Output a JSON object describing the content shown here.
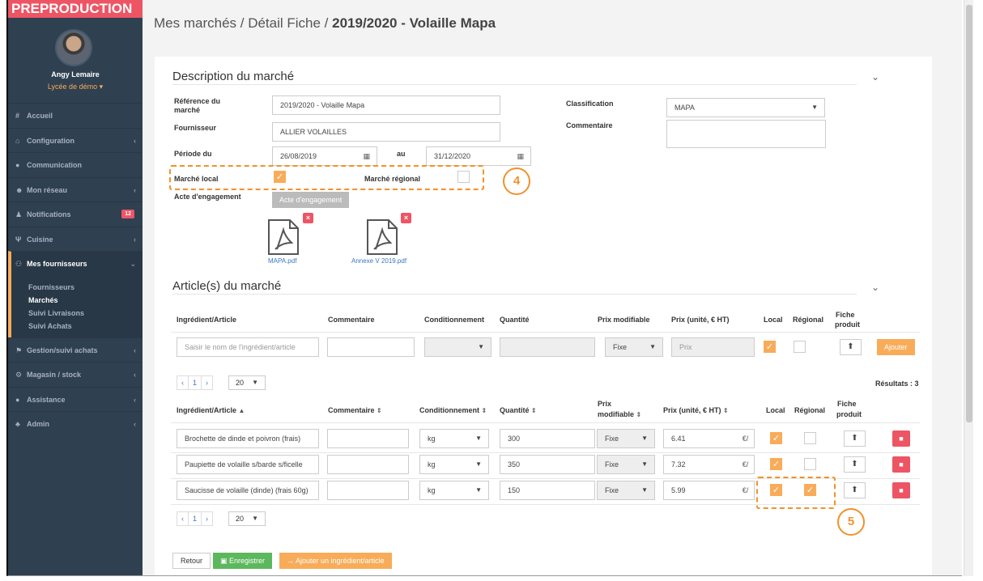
{
  "env_banner": "PREPRODUCTION",
  "user": {
    "name": "Angy Lemaire",
    "school": "Lycée de démo ▾"
  },
  "nav": {
    "items": [
      {
        "icon": "#",
        "label": "Accueil",
        "chevron": ""
      },
      {
        "icon": "⌂",
        "label": "Configuration",
        "chevron": "‹"
      },
      {
        "icon": "●",
        "label": "Communication",
        "chevron": ""
      },
      {
        "icon": "☻",
        "label": "Mon réseau",
        "chevron": "‹"
      },
      {
        "icon": "♟",
        "label": "Notifications",
        "badge": "12"
      },
      {
        "icon": "Ψ",
        "label": "Cuisine",
        "chevron": "‹"
      }
    ],
    "active": {
      "icon": "⚇",
      "label": "Mes fournisseurs",
      "chevron": "⌄"
    },
    "sub": [
      "Fournisseurs",
      "Marchés",
      "Suivi Livraisons",
      "Suivi Achats"
    ],
    "after": [
      {
        "icon": "⚑",
        "label": "Gestion/suivi achats",
        "chevron": "‹"
      },
      {
        "icon": "⚙",
        "label": "Magasin / stock",
        "chevron": "‹"
      },
      {
        "icon": "●",
        "label": "Assistance",
        "chevron": "‹"
      },
      {
        "icon": "♣",
        "label": "Admin",
        "chevron": "‹"
      }
    ]
  },
  "breadcrumb": {
    "part1": "Mes marchés / Détail Fiche / ",
    "current": "2019/2020 - Volaille Mapa"
  },
  "description": {
    "title": "Description du marché",
    "ref_label": "Référence du marché",
    "ref_value": "2019/2020 - Volaille Mapa",
    "fournisseur_label": "Fournisseur",
    "fournisseur_value": "ALLIER VOLAILLES",
    "periode_label": "Période du",
    "date_from": "26/08/2019",
    "au_label": "au",
    "date_to": "31/12/2020",
    "local_label": "Marché local",
    "regional_label": "Marché régional",
    "acte_label": "Acte d'engagement",
    "acte_button": "Acte d'engagement",
    "classification_label": "Classification",
    "classification_value": "MAPA",
    "commentaire_label": "Commentaire",
    "files": [
      "MAPA.pdf",
      "Annexe V 2019.pdf"
    ]
  },
  "callouts": {
    "c4": "4",
    "c5": "5"
  },
  "articles": {
    "title": "Article(s) du marché",
    "headers": {
      "ingredient": "Ingrédient/Article",
      "commentaire": "Commentaire",
      "conditionnement": "Conditionnement",
      "quantite": "Quantité",
      "prix_modifiable": "Prix modifiable",
      "prix_modifiable_l1": "Prix",
      "prix_modifiable_l2": "modifiable",
      "prix": "Prix (unité, € HT)",
      "local": "Local",
      "regional": "Régional",
      "fiche_l1": "Fiche",
      "fiche_l2": "produit"
    },
    "new_row": {
      "ingredient_placeholder": "Saisir le nom de l'ingrédient/article",
      "prix_type": "Fixe",
      "prix_placeholder": "Prix",
      "add_button": "Ajouter"
    },
    "pager": {
      "prev": "‹",
      "page": "1",
      "next": "›",
      "size": "20"
    },
    "results": "Résultats : 3",
    "rows": [
      {
        "ingredient": "Brochette de dinde et poivron (frais)",
        "cond": "kg",
        "qte": "300",
        "prix_type": "Fixe",
        "prix": "6.41",
        "unit": "€/",
        "local": true,
        "regional": false
      },
      {
        "ingredient": "Paupiette de volaille s/barde s/ficelle",
        "cond": "kg",
        "qte": "350",
        "prix_type": "Fixe",
        "prix": "7.32",
        "unit": "€/",
        "local": true,
        "regional": false
      },
      {
        "ingredient": "Saucisse de volaille (dinde) (frais 60g)",
        "cond": "kg",
        "qte": "150",
        "prix_type": "Fixe",
        "prix": "5.99",
        "unit": "€/",
        "local": true,
        "regional": true
      }
    ]
  },
  "footer": {
    "retour": "Retour",
    "enregistrer": "Enregistrer",
    "ajouter": "→ Ajouter un ingrédient/article"
  }
}
